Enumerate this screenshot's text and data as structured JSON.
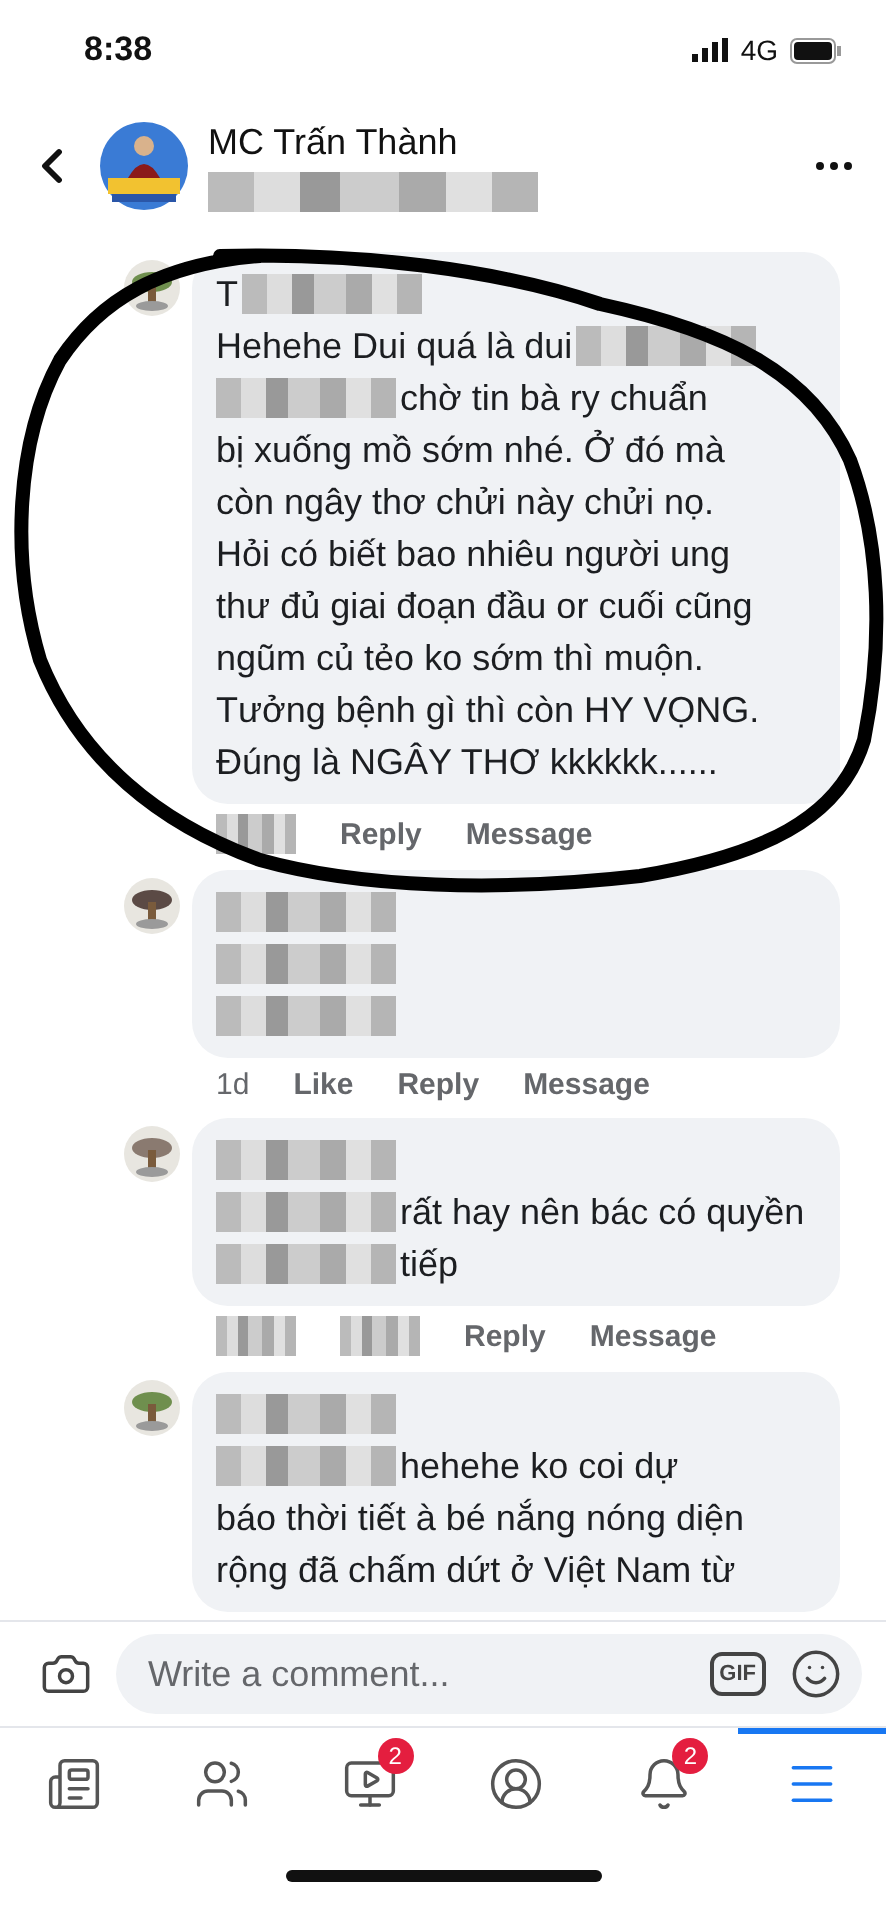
{
  "status_bar": {
    "time": "8:38",
    "network": "4G"
  },
  "header": {
    "page_name": "MC Trấn Thành",
    "subtitle_redacted": true
  },
  "comments": [
    {
      "lines": [
        [
          {
            "kind": "text",
            "text": "T"
          },
          {
            "kind": "redacted"
          }
        ],
        [
          {
            "kind": "text",
            "text": "Hehehe Dui quá là dui"
          },
          {
            "kind": "redacted"
          }
        ],
        [
          {
            "kind": "redacted"
          },
          {
            "kind": "text",
            "text": "chờ tin bà ry chuẩn"
          }
        ],
        [
          {
            "kind": "text",
            "text": "bị xuống mồ sớm nhé. Ở đó mà"
          }
        ],
        [
          {
            "kind": "text",
            "text": "còn ngây thơ chửi này chửi nọ."
          }
        ],
        [
          {
            "kind": "text",
            "text": "Hỏi có biết bao nhiêu người ung"
          }
        ],
        [
          {
            "kind": "text",
            "text": "thư đủ giai đoạn đầu or cuối cũng"
          }
        ],
        [
          {
            "kind": "text",
            "text": "ngũm củ tẻo ko sớm thì muộn."
          }
        ],
        [
          {
            "kind": "text",
            "text": "Tưởng bệnh gì thì còn HY VỌNG."
          }
        ],
        [
          {
            "kind": "text",
            "text": "Đúng là NGÂY THƠ kkkkkk......"
          }
        ]
      ],
      "actions": [
        {
          "kind": "redacted"
        },
        {
          "kind": "link",
          "text": "Reply"
        },
        {
          "kind": "link",
          "text": "Message"
        }
      ]
    },
    {
      "lines": [
        [
          {
            "kind": "redacted"
          }
        ],
        [
          {
            "kind": "redacted"
          }
        ],
        [
          {
            "kind": "redacted"
          }
        ]
      ],
      "actions": [
        {
          "kind": "time",
          "text": "1d"
        },
        {
          "kind": "link",
          "text": "Like"
        },
        {
          "kind": "link",
          "text": "Reply"
        },
        {
          "kind": "link",
          "text": "Message"
        }
      ]
    },
    {
      "lines": [
        [
          {
            "kind": "redacted"
          }
        ],
        [
          {
            "kind": "redacted"
          },
          {
            "kind": "text",
            "text": "rất hay nên bác có quyền"
          }
        ],
        [
          {
            "kind": "redacted"
          },
          {
            "kind": "text",
            "text": "tiếp"
          }
        ]
      ],
      "actions": [
        {
          "kind": "redacted"
        },
        {
          "kind": "redacted"
        },
        {
          "kind": "link",
          "text": "Reply"
        },
        {
          "kind": "link",
          "text": "Message"
        }
      ]
    },
    {
      "lines": [
        [
          {
            "kind": "redacted"
          }
        ],
        [
          {
            "kind": "redacted"
          },
          {
            "kind": "text",
            "text": "hehehe ko coi dự"
          }
        ],
        [
          {
            "kind": "text",
            "text": "báo thời tiết à bé nắng nóng diện"
          }
        ],
        [
          {
            "kind": "text",
            "text": "rộng đã chấm dứt ở Việt Nam từ"
          }
        ]
      ]
    }
  ],
  "composer": {
    "placeholder": "Write a comment...",
    "gif_label": "GIF"
  },
  "tab_bar": [
    {
      "selected": false
    },
    {
      "selected": false
    },
    {
      "selected": false,
      "badge": "2"
    },
    {
      "selected": false
    },
    {
      "selected": false,
      "badge": "2"
    },
    {
      "selected": true
    }
  ]
}
